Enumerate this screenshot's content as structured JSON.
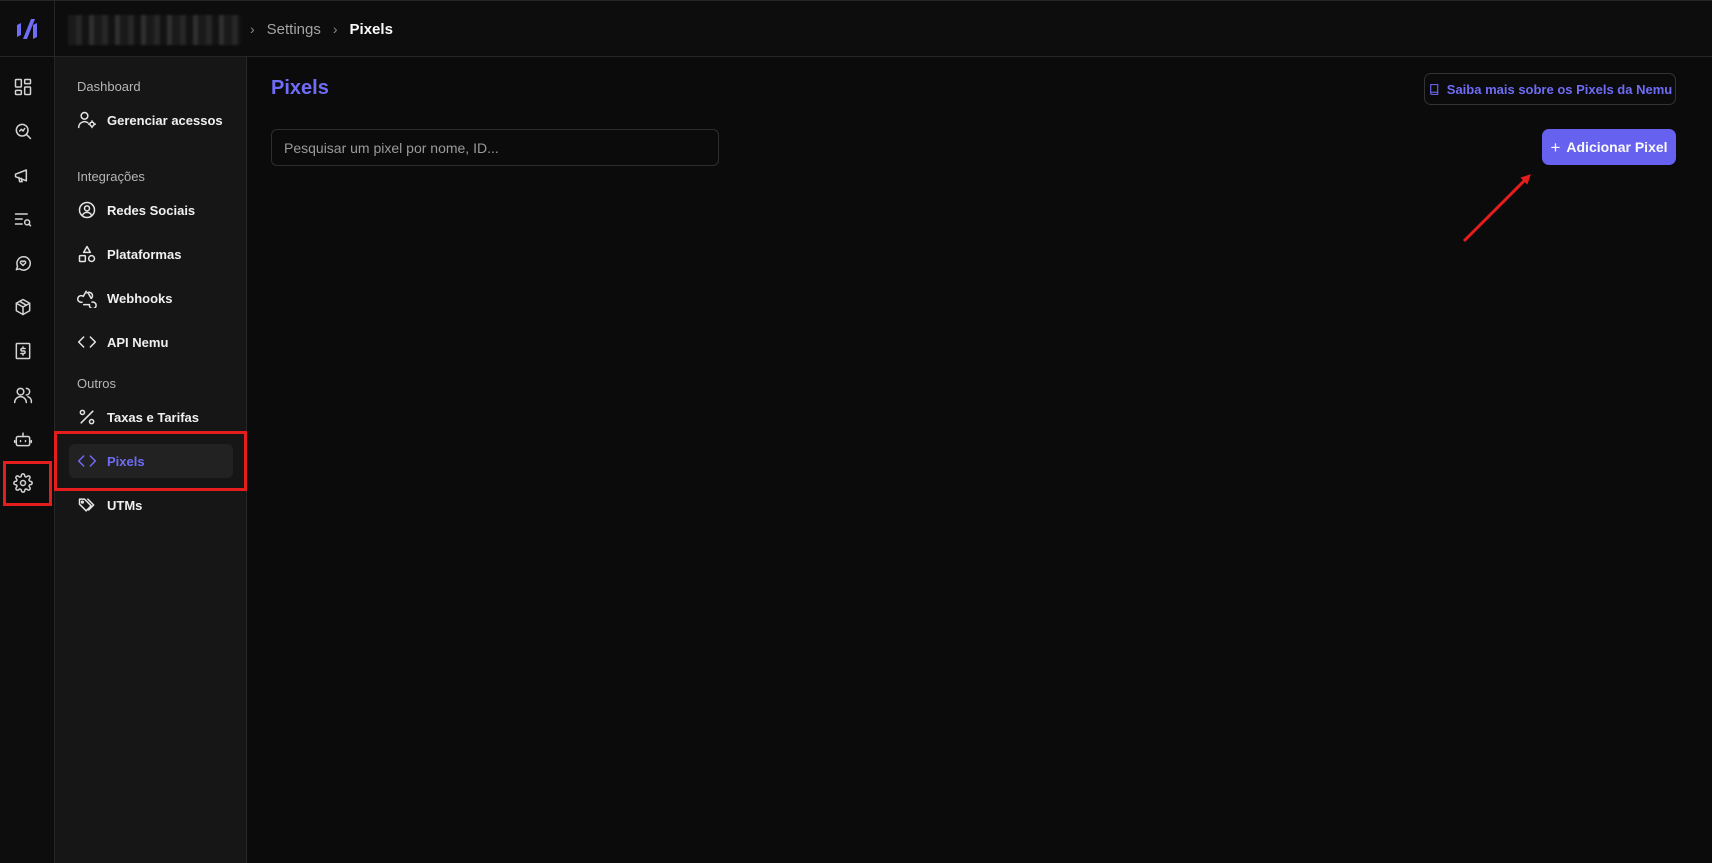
{
  "breadcrumb": {
    "items": [
      "Settings",
      "Pixels"
    ]
  },
  "rail": {
    "icons": [
      "dashboard-icon",
      "analytics-search-icon",
      "megaphone-icon",
      "list-search-icon",
      "chat-heart-icon",
      "package-icon",
      "dollar-receipt-icon",
      "users-icon",
      "bot-icon",
      "gear-icon"
    ],
    "active": "gear-icon"
  },
  "sidebar": {
    "dashboard_title": "Dashboard",
    "manage_access": "Gerenciar acessos",
    "integrations_title": "Integrações",
    "social": "Redes Sociais",
    "platforms": "Plataformas",
    "webhooks": "Webhooks",
    "api": "API Nemu",
    "others_title": "Outros",
    "fees": "Taxas e Tarifas",
    "pixels": "Pixels",
    "utms": "UTMs",
    "active_item": "Pixels"
  },
  "main": {
    "title": "Pixels",
    "learn_more": "Saiba mais sobre os Pixels da Nemu",
    "search_placeholder": "Pesquisar um pixel por nome, ID...",
    "search_value": "",
    "add_button": "Adicionar Pixel"
  },
  "colors": {
    "accent": "#6661ee",
    "annotation": "#e51d1d",
    "background": "#0b0b0b"
  }
}
